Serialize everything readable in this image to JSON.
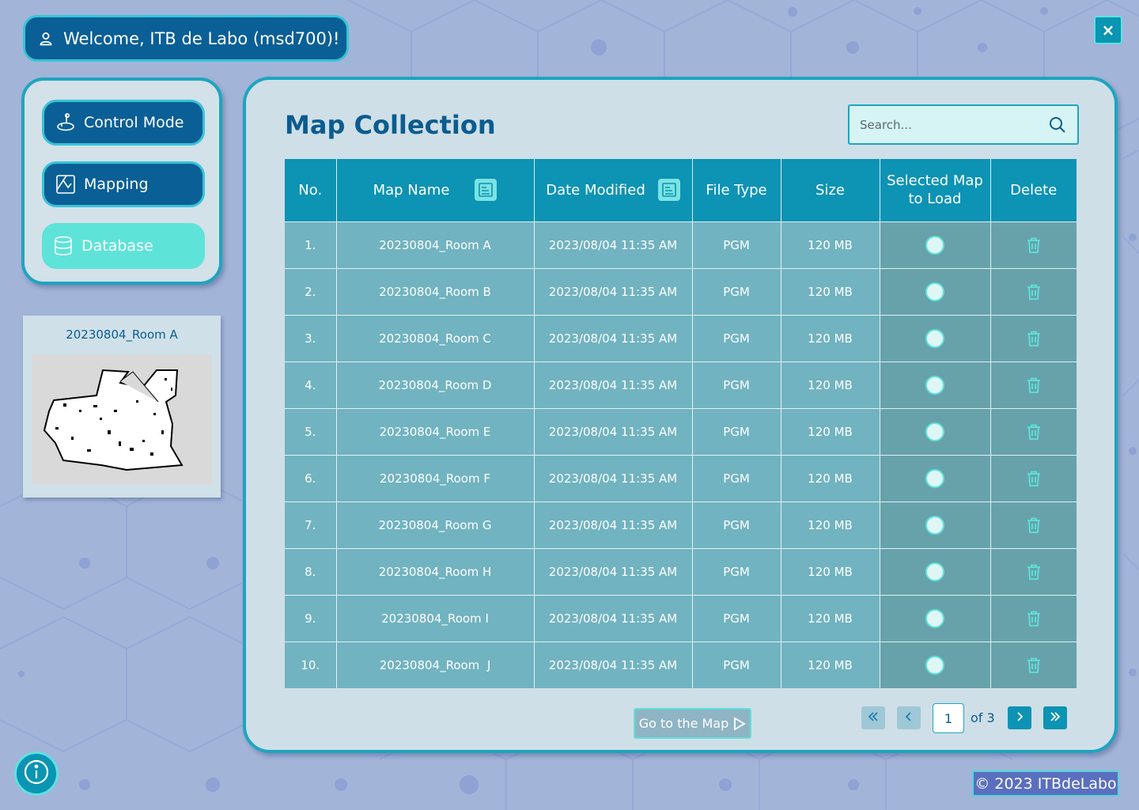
{
  "header": {
    "welcome_text": "Welcome, ITB de Labo (msd700)!"
  },
  "window": {
    "close_label": "×"
  },
  "nav": {
    "items": [
      {
        "label": "Control Mode",
        "icon": "joystick-icon"
      },
      {
        "label": "Mapping",
        "icon": "map-icon"
      },
      {
        "label": "Database",
        "icon": "database-icon",
        "active": true
      }
    ]
  },
  "preview": {
    "title": "20230804_Room A"
  },
  "main": {
    "title": "Map Collection",
    "search_placeholder": "Search...",
    "table": {
      "headers": {
        "no": "No.",
        "map_name": "Map Name",
        "date_modified": "Date Modified",
        "file_type": "File Type",
        "size": "Size",
        "selected": "Selected Map to Load",
        "delete": "Delete"
      },
      "rows": [
        {
          "no": "1.",
          "map_name": "20230804_Room A",
          "date_modified": "2023/08/04 11:35 AM",
          "file_type": "PGM",
          "size": "120 MB"
        },
        {
          "no": "2.",
          "map_name": "20230804_Room B",
          "date_modified": "2023/08/04 11:35 AM",
          "file_type": "PGM",
          "size": "120 MB"
        },
        {
          "no": "3.",
          "map_name": "20230804_Room C",
          "date_modified": "2023/08/04 11:35 AM",
          "file_type": "PGM",
          "size": "120 MB"
        },
        {
          "no": "4.",
          "map_name": "20230804_Room D",
          "date_modified": "2023/08/04 11:35 AM",
          "file_type": "PGM",
          "size": "120 MB"
        },
        {
          "no": "5.",
          "map_name": "20230804_Room E",
          "date_modified": "2023/08/04 11:35 AM",
          "file_type": "PGM",
          "size": "120 MB"
        },
        {
          "no": "6.",
          "map_name": "20230804_Room F",
          "date_modified": "2023/08/04 11:35 AM",
          "file_type": "PGM",
          "size": "120 MB"
        },
        {
          "no": "7.",
          "map_name": "20230804_Room G",
          "date_modified": "2023/08/04 11:35 AM",
          "file_type": "PGM",
          "size": "120 MB"
        },
        {
          "no": "8.",
          "map_name": "20230804_Room H",
          "date_modified": "2023/08/04 11:35 AM",
          "file_type": "PGM",
          "size": "120 MB"
        },
        {
          "no": "9.",
          "map_name": "20230804_Room I",
          "date_modified": "2023/08/04 11:35 AM",
          "file_type": "PGM",
          "size": "120 MB"
        },
        {
          "no": "10.",
          "map_name": "20230804_Room  J",
          "date_modified": "2023/08/04 11:35 AM",
          "file_type": "PGM",
          "size": "120 MB"
        }
      ]
    },
    "go_to_map_label": "Go to the Map",
    "pagination": {
      "current_page": "1",
      "of_label": "of 3"
    }
  },
  "footer": {
    "copyright": "© 2023 ITBdeLabo"
  },
  "colors": {
    "brand_dark": "#0a5f96",
    "accent_teal": "#1da5c0",
    "accent_mint": "#5ee3d9",
    "table_header": "#0d93b3",
    "table_row": "#71b3c0",
    "background": "#a3b4d9"
  }
}
